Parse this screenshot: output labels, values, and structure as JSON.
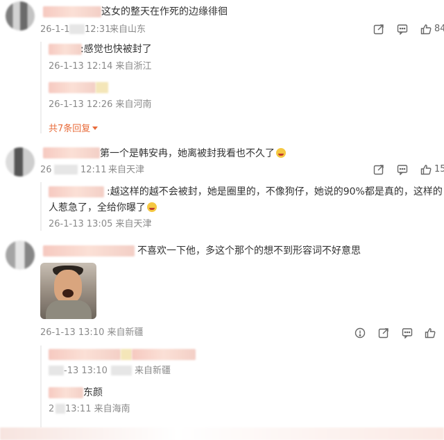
{
  "comments": [
    {
      "text": "这女的整天在作死的边缘徘徊",
      "date": "26-1-1",
      "time": "12:31",
      "location": "来自山东",
      "likes": "84",
      "replies": [
        {
          "text": ":感觉也快被封了",
          "date": "26-1-13",
          "time": "12:14",
          "location": "来自浙江"
        },
        {
          "text": "",
          "date": "26-1-13",
          "time": "12:26",
          "location": "来自河南"
        }
      ],
      "more_replies": "共7条回复"
    },
    {
      "text": "第一个是韩安冉，她离被封我看也不久了",
      "date": "26",
      "time": "12:11",
      "location": "来自天津",
      "likes": "15",
      "replies": [
        {
          "text_line1": ":越这样的越不会被封，她是圈里的，不像狗仔，她说的90%都是真的，这样的",
          "text_line2": "人惹急了，全给你曝了",
          "date": "26-1-13",
          "time": "13:05",
          "location": "来自天津"
        }
      ]
    },
    {
      "text": "不喜欢一下他，多这个那个的想不到形容词不好意思",
      "date": "26-1-13",
      "time": "13:10",
      "location": "来自新疆",
      "replies": [
        {
          "date": "-13",
          "time": "13:10",
          "location": "来自新疆"
        },
        {
          "text": "东颜",
          "date": "2",
          "time": "13:11",
          "location": "来自海南"
        }
      ]
    }
  ],
  "icons": [
    "share-icon",
    "comment-icon",
    "like-icon",
    "report-icon"
  ]
}
